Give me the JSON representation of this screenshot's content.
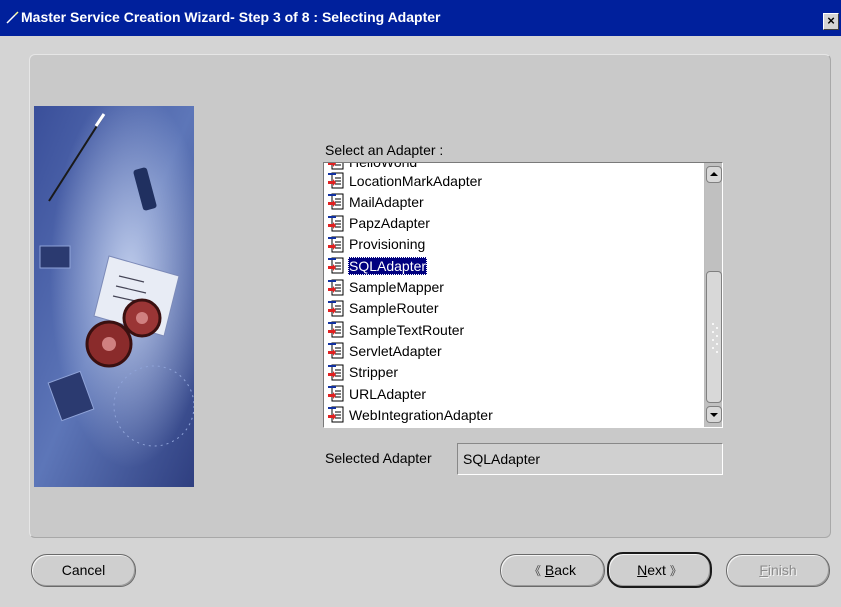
{
  "window": {
    "title": "Master Service Creation Wizard- Step 3 of 8 : Selecting Adapter",
    "close_label": "×"
  },
  "adapter_list": {
    "label": "Select an Adapter :",
    "partial_top_item": "HelloWorld",
    "items": [
      {
        "label": "LocationMarkAdapter",
        "selected": false
      },
      {
        "label": "MailAdapter",
        "selected": false
      },
      {
        "label": "PapzAdapter",
        "selected": false
      },
      {
        "label": "Provisioning",
        "selected": false
      },
      {
        "label": "SQLAdapter",
        "selected": true
      },
      {
        "label": "SampleMapper",
        "selected": false
      },
      {
        "label": "SampleRouter",
        "selected": false
      },
      {
        "label": "SampleTextRouter",
        "selected": false
      },
      {
        "label": "ServletAdapter",
        "selected": false
      },
      {
        "label": "Stripper",
        "selected": false
      },
      {
        "label": "URLAdapter",
        "selected": false
      },
      {
        "label": "WebIntegrationAdapter",
        "selected": false
      }
    ],
    "item_icon": "adapter-document-icon"
  },
  "selected_adapter": {
    "label": "Selected Adapter",
    "value": "SQLAdapter"
  },
  "buttons": {
    "cancel": "Cancel",
    "back_mnemonic": "B",
    "back_rest": "ack",
    "back_arrow": "《",
    "next_mnemonic": "N",
    "next_rest": "ext",
    "next_arrow": "》",
    "finish_mnemonic": "F",
    "finish_rest": "inish",
    "finish_enabled": false
  },
  "colors": {
    "titlebar": "#00209c",
    "selection": "#000080",
    "window_bg": "#d4d4d4",
    "panel_bg": "#c9c9c9"
  }
}
